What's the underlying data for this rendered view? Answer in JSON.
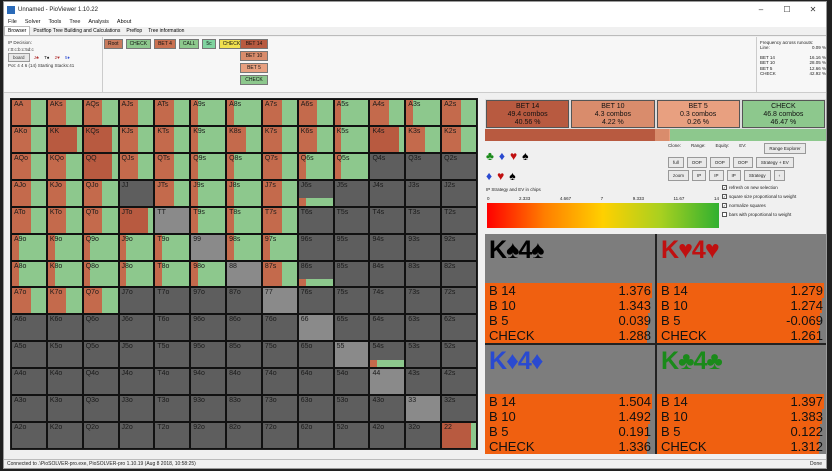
{
  "window": {
    "title": "Unnamed - PioViewer 1.10.22",
    "minimize": "–",
    "maximize": "☐",
    "close": "✕"
  },
  "menu": [
    "File",
    "Solver",
    "Tools",
    "Tree",
    "Analysis",
    "About"
  ],
  "tabs": [
    "Browser",
    "Postflop Tree Building and Calculations",
    "Preflop",
    "Tree information"
  ],
  "left_info": {
    "heading": "IP Decision:",
    "line": "r:0:c:b:c:5d:c",
    "board_btn": "board",
    "cards": [
      "J♣",
      "T♠",
      "2♥",
      "5♦"
    ],
    "pot": "Pot: 4 4 6 (14) Starting Stacks:41"
  },
  "actions": [
    {
      "label": "Root",
      "color": "#c87a5c"
    },
    {
      "label": "CHECK",
      "color": "#8dc88d"
    },
    {
      "label": "BET 4",
      "color": "#c97050"
    },
    {
      "label": "CALL",
      "color": "#8dc88d"
    },
    {
      "label": "5c",
      "color": "#80d4a0"
    },
    {
      "label": "CHECK",
      "color": "#f0e050"
    }
  ],
  "bet_col": [
    {
      "label": "BET 14",
      "color": "#b85a40"
    },
    {
      "label": "BET 10",
      "color": "#d98c6c"
    },
    {
      "label": "BET 5",
      "color": "#e8a080"
    },
    {
      "label": "CHECK",
      "color": "#8dc88d"
    }
  ],
  "freq": {
    "title": "Frequency across runouts:",
    "rows": [
      {
        "name": "Line:",
        "value": "0.09 %"
      },
      {
        "name": "BET 14",
        "value": "16.16 %"
      },
      {
        "name": "BET 10",
        "value": "28.05 %"
      },
      {
        "name": "BET 5",
        "value": "12.66 %"
      },
      {
        "name": "CHECK",
        "value": "42.92 %"
      }
    ]
  },
  "grid": {
    "ranks": [
      "A",
      "K",
      "Q",
      "J",
      "T",
      "9",
      "8",
      "7",
      "6",
      "5",
      "4",
      "3",
      "2"
    ],
    "cells": [
      [
        "AA:1:m",
        "AKs:1:m",
        "AQs:1:m",
        "AJs:1:m",
        "ATs:1:m",
        "A9s:1:g",
        "A8s:1:g",
        "A7s:1:m",
        "A6s:1:m",
        "A5s:1:g",
        "A4s:1:m",
        "A3s:1:g",
        "A2s:1:m"
      ],
      [
        "AKo:1:m",
        "KK:1:r",
        "KQs:1:r",
        "KJs:1:m",
        "KTs:1:m",
        "K9s:1:g",
        "K8s:1:m",
        "K7s:1:m",
        "K6s:1:m",
        "K5s:1:g",
        "K4s:1:r",
        "K3s:1:m",
        "K2s:1:m"
      ],
      [
        "AQo:1:m",
        "KQo:1:m",
        "QQ:1:r",
        "QJs:1:m",
        "QTs:1:m",
        "Q9s:1:g",
        "Q8s:1:g",
        "Q7s:1:m",
        "Q6s:1:g",
        "Q5s:1:g",
        "Q4s:0:n",
        "Q3s:0:n",
        "Q2s:0:n"
      ],
      [
        "AJo:1:m",
        "KJo:1:m",
        "QJo:1:m",
        "JJ:0:n",
        "JTs:1:m",
        "J9s:1:g",
        "J8s:1:g",
        "J7s:1:m",
        "J6s:0.3:g",
        "J5s:0:n",
        "J4s:0:n",
        "J3s:0:n",
        "J2s:0:n"
      ],
      [
        "ATo:1:m",
        "KTo:1:m",
        "QTo:1:m",
        "JTo:1:r",
        "TT:1:n",
        "T9s:1:g",
        "T8s:1:g",
        "T7s:1:m",
        "T6s:0:n",
        "T5s:0:n",
        "T4s:0:n",
        "T3s:0:n",
        "T2s:0:n"
      ],
      [
        "A9o:1:g",
        "K9o:1:g",
        "Q9o:1:g",
        "J9o:1:g",
        "T9o:1:g",
        "99:1:n",
        "98s:1:g",
        "97s:1:g",
        "96s:0:n",
        "95s:0:n",
        "94s:0:n",
        "93s:0:n",
        "92s:0:n"
      ],
      [
        "A8o:1:g",
        "K8o:1:g",
        "Q8o:1:g",
        "J8o:1:g",
        "T8o:1:g",
        "98o:1:g",
        "88:1:n",
        "87s:1:m",
        "86s:0.3:g",
        "85s:0:n",
        "84s:0:n",
        "83s:0:n",
        "82s:0:n"
      ],
      [
        "A7o:1:m",
        "K7o:1:m",
        "Q7o:1:m",
        "J7o:0:n",
        "T7o:0:n",
        "97o:0:n",
        "87o:0:n",
        "77:1:n",
        "76s:0:n",
        "75s:0:n",
        "74s:0:n",
        "73s:0:n",
        "72s:0:n"
      ],
      [
        "A6o:0:n",
        "K6o:0:n",
        "Q6o:0:n",
        "J6o:0:n",
        "T6o:0:n",
        "96o:0:n",
        "86o:0:n",
        "76o:0:n",
        "66:1:n",
        "65s:0:n",
        "64s:0:n",
        "63s:0:n",
        "62s:0:n"
      ],
      [
        "A5o:0:n",
        "K5o:0:n",
        "Q5o:0:n",
        "J5o:0:n",
        "T5o:0:n",
        "95o:0:n",
        "85o:0:n",
        "75o:0:n",
        "65o:0:n",
        "55:1:n",
        "54s:0.3:g",
        "53s:0:n",
        "52s:0:n"
      ],
      [
        "A4o:0:n",
        "K4o:0:n",
        "Q4o:0:n",
        "J4o:0:n",
        "T4o:0:n",
        "94o:0:n",
        "84o:0:n",
        "74o:0:n",
        "64o:0:n",
        "54o:0:n",
        "44:1:n",
        "43s:0:n",
        "42s:0:n"
      ],
      [
        "A3o:0:n",
        "K3o:0:n",
        "Q3o:0:n",
        "J3o:0:n",
        "T3o:0:n",
        "93o:0:n",
        "83o:0:n",
        "73o:0:n",
        "63o:0:n",
        "53o:0:n",
        "43o:0:n",
        "33:1:n",
        "32s:0:n"
      ],
      [
        "A2o:0:n",
        "K2o:0:n",
        "Q2o:0:n",
        "J2o:0:n",
        "T2o:0:n",
        "92o:0:n",
        "82o:0:n",
        "72o:0:n",
        "62o:0:n",
        "52o:0:n",
        "42o:0:n",
        "32o:0:n",
        "22:1:r"
      ]
    ]
  },
  "strategy_boxes": [
    {
      "label": "BET 14",
      "combos": "49.4 combos",
      "pct": "40.56 %",
      "color": "#b85a40"
    },
    {
      "label": "BET 10",
      "combos": "4.3 combos",
      "pct": "4.22 %",
      "color": "#d98c6c"
    },
    {
      "label": "BET 5",
      "combos": "0.3 combos",
      "pct": "0.26 %",
      "color": "#e8a080"
    },
    {
      "label": "CHECK",
      "combos": "46.8 combos",
      "pct": "46.47 %",
      "color": "#8dc88d"
    }
  ],
  "strategy_bar": [
    {
      "share": 0.5056,
      "color": "#b85a40"
    },
    {
      "share": 0.0422,
      "color": "#d98c6c"
    },
    {
      "share": 0.0026,
      "color": "#e8a080"
    },
    {
      "share": 0.4647,
      "color": "#8dc88d"
    }
  ],
  "suits_row1": [
    {
      "s": "♣",
      "c": "#1a8a1a"
    },
    {
      "s": "♦",
      "c": "#2a4ad0"
    },
    {
      "s": "♥",
      "c": "#c01010"
    },
    {
      "s": "♠",
      "c": "#000000"
    }
  ],
  "suits_row2": [
    {
      "s": "♦",
      "c": "#2a4ad0"
    },
    {
      "s": "♥",
      "c": "#c01010"
    },
    {
      "s": "♠",
      "c": "#000000"
    }
  ],
  "controls": {
    "headers": [
      "Clone:",
      "Range:",
      "Equity:",
      "EV:"
    ],
    "range_explorer": "Range Explorer",
    "strategy_ev": "Strategy + EV",
    "strategy": "Strategy",
    "full": "full",
    "zoom": "zoom",
    "oop": "OOP",
    "ip": "IP",
    "arrow": "‹",
    "checks": [
      {
        "label": "refresh on new selection",
        "checked": true
      },
      {
        "label": "square size proportional to weight",
        "checked": true
      },
      {
        "label": "normalize squares",
        "checked": true
      },
      {
        "label": "bars with proportional to weight",
        "checked": false
      }
    ]
  },
  "ev_label": "IP Strategy and EV in chips",
  "ev_scale": [
    "0",
    "2.333",
    "4.667",
    "7",
    "9.333",
    "11.67",
    "14"
  ],
  "combos": [
    {
      "rank1": "K",
      "suit1": "♠",
      "rank2": "4",
      "suit2": "♠",
      "color": "#000000",
      "rows": [
        {
          "n": "B 14",
          "v": "1.376",
          "f": 0.98
        },
        {
          "n": "B 10",
          "v": "1.343",
          "f": 0.97
        },
        {
          "n": "B 5",
          "v": "0.039",
          "f": 0.96
        },
        {
          "n": "CHECK",
          "v": "1.288",
          "f": 0.95
        }
      ]
    },
    {
      "rank1": "K",
      "suit1": "♥",
      "rank2": "4",
      "suit2": "♥",
      "color": "#c01010",
      "rows": [
        {
          "n": "B 14",
          "v": "1.279",
          "f": 0.98
        },
        {
          "n": "B 10",
          "v": "1.274",
          "f": 0.97
        },
        {
          "n": "B 5",
          "v": "-0.069",
          "f": 0.96
        },
        {
          "n": "CHECK",
          "v": "1.261",
          "f": 0.95
        }
      ]
    },
    {
      "rank1": "K",
      "suit1": "♦",
      "rank2": "4",
      "suit2": "♦",
      "color": "#2a4ad0",
      "rows": [
        {
          "n": "B 14",
          "v": "1.504",
          "f": 0.98
        },
        {
          "n": "B 10",
          "v": "1.492",
          "f": 0.97
        },
        {
          "n": "B 5",
          "v": "0.191",
          "f": 0.96
        },
        {
          "n": "CHECK",
          "v": "1.336",
          "f": 0.95
        }
      ]
    },
    {
      "rank1": "K",
      "suit1": "♣",
      "rank2": "4",
      "suit2": "♣",
      "color": "#1a8a1a",
      "rows": [
        {
          "n": "B 14",
          "v": "1.397",
          "f": 0.98
        },
        {
          "n": "B 10",
          "v": "1.383",
          "f": 0.97
        },
        {
          "n": "B 5",
          "v": "0.122",
          "f": 0.96
        },
        {
          "n": "CHECK",
          "v": "1.312",
          "f": 0.95
        }
      ]
    }
  ],
  "status": {
    "text": "Connected to .\\PioSOLVER-pro.exe, PioSOLVER-pro 1.10.19 (Aug 8 2018, 10:58:25)",
    "done": "Done"
  },
  "colors": {
    "mixed_red": "#c46a4c",
    "red": "#b85a40",
    "green": "#8dc88d",
    "grey": "#8a8a8a"
  }
}
